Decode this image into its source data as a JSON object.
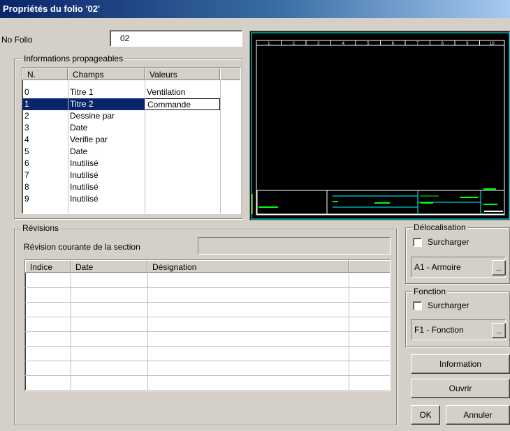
{
  "window": {
    "title": "Propriétés du folio '02'"
  },
  "folio": {
    "label": "No Folio",
    "value": "02"
  },
  "info": {
    "legend": "Informations propageables",
    "headers": [
      "N.",
      "Champs",
      "Valeurs"
    ],
    "rows": [
      {
        "n": "0",
        "champ": "Titre 1",
        "valeur": "Ventilation"
      },
      {
        "n": "1",
        "champ": "Titre 2",
        "valeur": "Commande"
      },
      {
        "n": "2",
        "champ": "Dessine par",
        "valeur": ""
      },
      {
        "n": "3",
        "champ": "Date",
        "valeur": ""
      },
      {
        "n": "4",
        "champ": "Verifie par",
        "valeur": ""
      },
      {
        "n": "5",
        "champ": "Date",
        "valeur": ""
      },
      {
        "n": "6",
        "champ": "Inutilisé",
        "valeur": ""
      },
      {
        "n": "7",
        "champ": "Inutilisé",
        "valeur": ""
      },
      {
        "n": "8",
        "champ": "Inutilisé",
        "valeur": ""
      },
      {
        "n": "9",
        "champ": "Inutilisé",
        "valeur": ""
      }
    ],
    "selected_row": 1
  },
  "preview": {
    "ruler_numbers": [
      "1",
      "2",
      "3",
      "4",
      "5",
      "6",
      "7",
      "8",
      "9",
      "10"
    ],
    "colors": {
      "background": "#000000",
      "frame": "#ffffff",
      "accent": "#00ffff",
      "green": "#00ff00"
    }
  },
  "revisions": {
    "legend": "Révisions",
    "current_label": "Révision courante de la section",
    "current_value": "",
    "headers": [
      "Indice",
      "Date",
      "Désignation"
    ]
  },
  "delocalisation": {
    "legend": "Délocalisation",
    "checkbox_label": "Surcharger",
    "checked": false,
    "value": "A1 - Armoire",
    "browse_label": "..."
  },
  "fonction": {
    "legend": "Fonction",
    "checkbox_label": "Surcharger",
    "checked": false,
    "value": "F1 - Fonction",
    "browse_label": "..."
  },
  "buttons": {
    "information": "Information",
    "ouvrir": "Ouvrir",
    "ok": "OK",
    "annuler": "Annuler"
  }
}
